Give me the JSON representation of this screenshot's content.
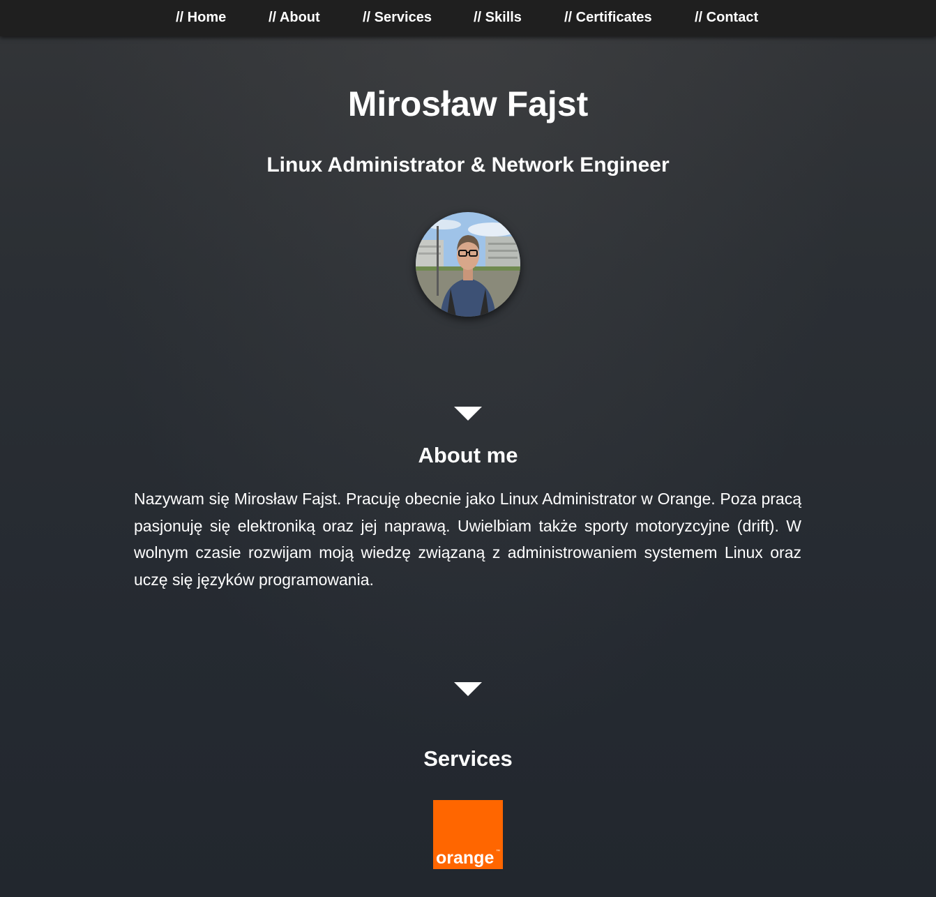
{
  "nav": {
    "items": [
      {
        "label": "// Home"
      },
      {
        "label": "// About"
      },
      {
        "label": "// Services"
      },
      {
        "label": "// Skills"
      },
      {
        "label": "// Certificates"
      },
      {
        "label": "// Contact"
      }
    ]
  },
  "hero": {
    "name": "Mirosław Fajst",
    "subtitle": "Linux Administrator & Network Engineer",
    "avatar_icon": "profile-photo"
  },
  "about": {
    "heading": "About me",
    "text": "Nazywam się Mirosław Fajst. Pracuję obecnie jako Linux Administrator w Orange. Poza pracą pasjonuję się elektroniką oraz jej naprawą. Uwielbiam także sporty motoryzcyjne (drift). W wolnym czasie rozwijam moją wiedzę związaną z administrowaniem systemem Linux oraz uczę się języków programowania."
  },
  "services": {
    "heading": "Services",
    "logo_text": "orange",
    "logo_mark": "™",
    "logo_color": "#ff6600"
  },
  "colors": {
    "navbar": "#1f1f1f",
    "text": "#ffffff",
    "background": "#2a2f35"
  }
}
